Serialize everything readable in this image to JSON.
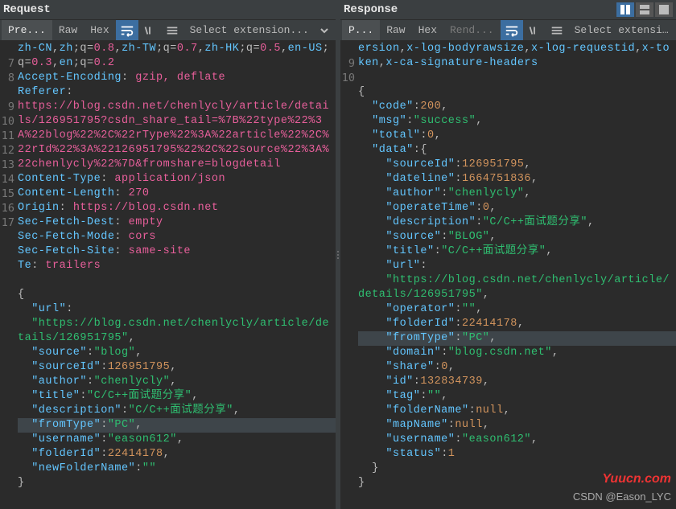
{
  "request": {
    "title": "Request",
    "tabs": {
      "active": "Pre...",
      "raw": "Raw",
      "hex": "Hex"
    },
    "extension_placeholder": "Select extension...",
    "lines": [
      {
        "n": "",
        "kind": "wrap",
        "html": "<span class='k'>zh-CN</span>,<span class='k'>zh</span>;q=<span class='v'>0.8</span>,<span class='k'>zh-TW</span>;q=<span class='v'>0.7</span>,<span class='k'>zh-HK</span>;q=<span class='v'>0.5</span>,<span class='k'>en-US</span>;q=<span class='v'>0.3</span>,<span class='k'>en</span>;q=<span class='v'>0.2</span>"
      },
      {
        "n": "7",
        "html": "<span class='k'>Accept-Encoding</span>: <span class='v'>gzip, deflate</span>"
      },
      {
        "n": "8",
        "html": "<span class='k'>Referer</span>:"
      },
      {
        "n": "",
        "kind": "wrap",
        "html": "<span class='v'>https://blog.csdn.net/chenlycly/article/details/126951795?csdn_share_tail=%7B%22type%22%3A%22blog%22%2C%22rType%22%3A%22article%22%2C%22rId%22%3A%22126951795%22%2C%22source%22%3A%22chenlycly%22%7D&fromshare=blogdetail</span>"
      },
      {
        "n": "9",
        "html": "<span class='k'>Content-Type</span>: <span class='v'>application/json</span>"
      },
      {
        "n": "10",
        "html": "<span class='k'>Content-Length</span>: <span class='v'>270</span>"
      },
      {
        "n": "11",
        "html": "<span class='k'>Origin</span>: <span class='v'>https://blog.csdn.net</span>"
      },
      {
        "n": "12",
        "html": "<span class='k'>Sec-Fetch-Dest</span>: <span class='v'>empty</span>"
      },
      {
        "n": "13",
        "html": "<span class='k'>Sec-Fetch-Mode</span>: <span class='v'>cors</span>"
      },
      {
        "n": "14",
        "html": "<span class='k'>Sec-Fetch-Site</span>: <span class='v'>same-site</span>"
      },
      {
        "n": "15",
        "html": "<span class='k'>Te</span>: <span class='v'>trailers</span>"
      },
      {
        "n": "16",
        "html": ""
      },
      {
        "n": "17",
        "html": "<span class='punct'>{</span>"
      },
      {
        "n": "",
        "kind": "body",
        "html": "  <span class='k'>\"url\"</span>:"
      },
      {
        "n": "",
        "kind": "body",
        "html": "  <span class='s'>\"https://blog.csdn.net/chenlycly/article/details/126951795\"</span>,"
      },
      {
        "n": "",
        "kind": "body",
        "html": "  <span class='k'>\"source\"</span>:<span class='s'>\"blog\"</span>,"
      },
      {
        "n": "",
        "kind": "body",
        "html": "  <span class='k'>\"sourceId\"</span>:<span class='n'>126951795</span>,"
      },
      {
        "n": "",
        "kind": "body",
        "html": "  <span class='k'>\"author\"</span>:<span class='s'>\"chenlycly\"</span>,"
      },
      {
        "n": "",
        "kind": "body",
        "html": "  <span class='k'>\"title\"</span>:<span class='s'>\"C/C++面试题分享\"</span>,"
      },
      {
        "n": "",
        "kind": "body",
        "html": "  <span class='k'>\"description\"</span>:<span class='s'>\"C/C++面试题分享\"</span>,"
      },
      {
        "n": "",
        "kind": "body",
        "hl": true,
        "html": "  <span class='k'>\"fromType\"</span>:<span class='s'>\"PC\"</span>,"
      },
      {
        "n": "",
        "kind": "body",
        "html": "  <span class='k'>\"username\"</span>:<span class='s'>\"eason612\"</span>,"
      },
      {
        "n": "",
        "kind": "body",
        "html": "  <span class='k'>\"folderId\"</span>:<span class='n'>22414178</span>,"
      },
      {
        "n": "",
        "kind": "body",
        "html": "  <span class='k'>\"newFolderName\"</span>:<span class='s'>\"\"</span>"
      },
      {
        "n": "",
        "kind": "body",
        "html": "<span class='punct'>}</span>"
      }
    ]
  },
  "response": {
    "title": "Response",
    "tabs": {
      "active": "P...",
      "raw": "Raw",
      "hex": "Hex",
      "render": "Rend..."
    },
    "extension_placeholder": "Select extension...",
    "lines": [
      {
        "n": "",
        "kind": "wrap",
        "html": "<span class='k'>ersion</span>,<span class='k'>x-log-bodyrawsize</span>,<span class='k'>x-log-requestid</span>,<span class='k'>x-token</span>,<span class='k'>x-ca-signature-headers</span>"
      },
      {
        "n": "9",
        "html": ""
      },
      {
        "n": "10",
        "html": "<span class='punct'>{</span>"
      },
      {
        "n": "",
        "kind": "body",
        "html": "  <span class='k'>\"code\"</span>:<span class='n'>200</span>,"
      },
      {
        "n": "",
        "kind": "body",
        "html": "  <span class='k'>\"msg\"</span>:<span class='s'>\"success\"</span>,"
      },
      {
        "n": "",
        "kind": "body",
        "html": "  <span class='k'>\"total\"</span>:<span class='n'>0</span>,"
      },
      {
        "n": "",
        "kind": "body",
        "html": "  <span class='k'>\"data\"</span>:<span class='punct'>{</span>"
      },
      {
        "n": "",
        "kind": "body",
        "html": "    <span class='k'>\"sourceId\"</span>:<span class='n'>126951795</span>,"
      },
      {
        "n": "",
        "kind": "body",
        "html": "    <span class='k'>\"dateline\"</span>:<span class='n'>1664751836</span>,"
      },
      {
        "n": "",
        "kind": "body",
        "html": "    <span class='k'>\"author\"</span>:<span class='s'>\"chenlycly\"</span>,"
      },
      {
        "n": "",
        "kind": "body",
        "html": "    <span class='k'>\"operateTime\"</span>:<span class='n'>0</span>,"
      },
      {
        "n": "",
        "kind": "body",
        "html": "    <span class='k'>\"description\"</span>:<span class='s'>\"C/C++面试题分享\"</span>,"
      },
      {
        "n": "",
        "kind": "body",
        "html": "    <span class='k'>\"source\"</span>:<span class='s'>\"BLOG\"</span>,"
      },
      {
        "n": "",
        "kind": "body",
        "html": "    <span class='k'>\"title\"</span>:<span class='s'>\"C/C++面试题分享\"</span>,"
      },
      {
        "n": "",
        "kind": "body",
        "html": "    <span class='k'>\"url\"</span>:"
      },
      {
        "n": "",
        "kind": "body",
        "html": "    <span class='s'>\"https://blog.csdn.net/chenlycly/article/details/126951795\"</span>,"
      },
      {
        "n": "",
        "kind": "body",
        "html": "    <span class='k'>\"operator\"</span>:<span class='s'>\"\"</span>,"
      },
      {
        "n": "",
        "kind": "body",
        "html": "    <span class='k'>\"folderId\"</span>:<span class='n'>22414178</span>,"
      },
      {
        "n": "",
        "kind": "body",
        "hl": true,
        "html": "    <span class='k'>\"fromType\"</span>:<span class='s'>\"PC\"</span>,"
      },
      {
        "n": "",
        "kind": "body",
        "html": "    <span class='k'>\"domain\"</span>:<span class='s'>\"blog.csdn.net\"</span>,"
      },
      {
        "n": "",
        "kind": "body",
        "html": "    <span class='k'>\"share\"</span>:<span class='n'>0</span>,"
      },
      {
        "n": "",
        "kind": "body",
        "html": "    <span class='k'>\"id\"</span>:<span class='n'>132834739</span>,"
      },
      {
        "n": "",
        "kind": "body",
        "html": "    <span class='k'>\"tag\"</span>:<span class='s'>\"\"</span>,"
      },
      {
        "n": "",
        "kind": "body",
        "html": "    <span class='k'>\"folderName\"</span>:<span class='nul'>null</span>,"
      },
      {
        "n": "",
        "kind": "body",
        "html": "    <span class='k'>\"mapName\"</span>:<span class='nul'>null</span>,"
      },
      {
        "n": "",
        "kind": "body",
        "html": "    <span class='k'>\"username\"</span>:<span class='s'>\"eason612\"</span>,"
      },
      {
        "n": "",
        "kind": "body",
        "html": "    <span class='k'>\"status\"</span>:<span class='n'>1</span>"
      },
      {
        "n": "",
        "kind": "body",
        "html": "  <span class='punct'>}</span>"
      },
      {
        "n": "",
        "kind": "body",
        "html": "<span class='punct'>}</span>"
      }
    ]
  },
  "watermark1": "Yuucn.com",
  "watermark2": "CSDN @Eason_LYC"
}
